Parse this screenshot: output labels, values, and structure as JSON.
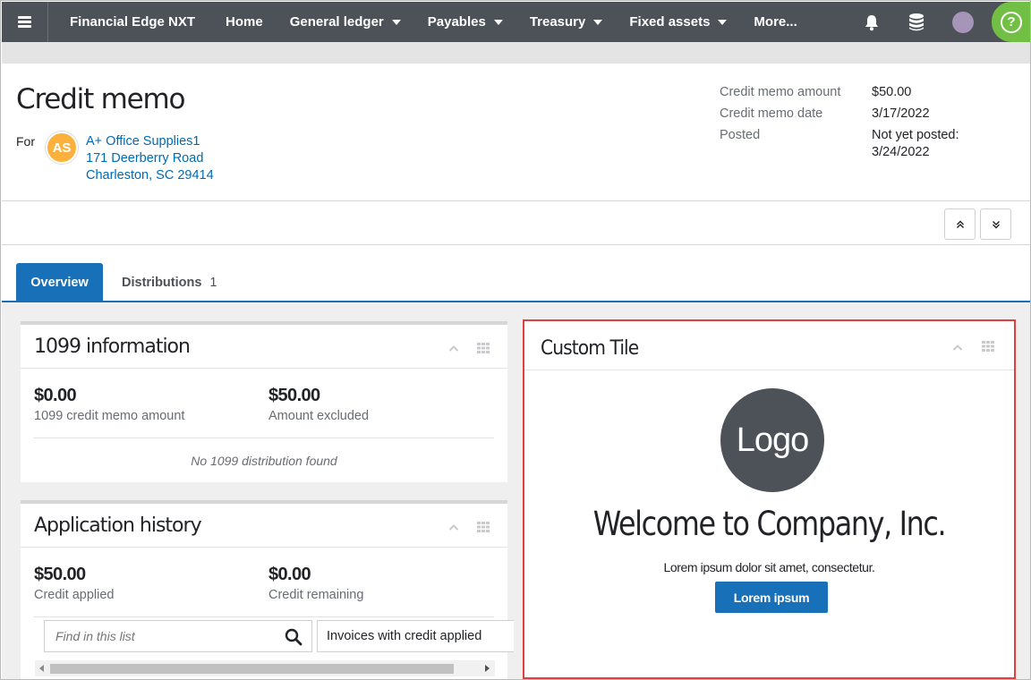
{
  "nav": {
    "brand": "Financial Edge NXT",
    "items": [
      "Home",
      "General ledger",
      "Payables",
      "Treasury",
      "Fixed assets",
      "More..."
    ],
    "help_label": "?"
  },
  "header": {
    "title": "Credit memo",
    "for_label": "For",
    "vendor_initials": "AS",
    "vendor_name": "A+ Office Supplies1",
    "vendor_street": "171 Deerberry Road",
    "vendor_city": "Charleston, SC 29414",
    "summary": [
      {
        "label": "Credit memo amount",
        "value": "$50.00"
      },
      {
        "label": "Credit memo date",
        "value": "3/17/2022"
      },
      {
        "label": "Posted",
        "value": "Not yet posted: 3/24/2022"
      }
    ]
  },
  "tabs": [
    {
      "label": "Overview",
      "active": true
    },
    {
      "label": "Distributions",
      "count": "1"
    }
  ],
  "tile_1099": {
    "title": "1099 information",
    "metrics": [
      {
        "value": "$0.00",
        "label": "1099 credit memo amount"
      },
      {
        "value": "$50.00",
        "label": "Amount excluded"
      }
    ],
    "empty_message": "No 1099 distribution found"
  },
  "tile_history": {
    "title": "Application history",
    "metrics": [
      {
        "value": "$50.00",
        "label": "Credit applied"
      },
      {
        "value": "$0.00",
        "label": "Credit remaining"
      }
    ],
    "search_placeholder": "Find in this list",
    "filter_label": "Invoices with credit applied"
  },
  "custom_tile": {
    "title": "Custom  Tile",
    "logo_text": "Logo",
    "welcome": "Welcome to Company, Inc.",
    "body": "Lorem ipsum dolor sit amet, consectetur.",
    "button_label": "Lorem ipsum"
  },
  "colors": {
    "nav_bg": "#4d5259",
    "accent": "#1870b8",
    "help_green": "#71bf44",
    "vendor_avatar": "#fbb13c",
    "highlight_border": "#e23e3e"
  }
}
